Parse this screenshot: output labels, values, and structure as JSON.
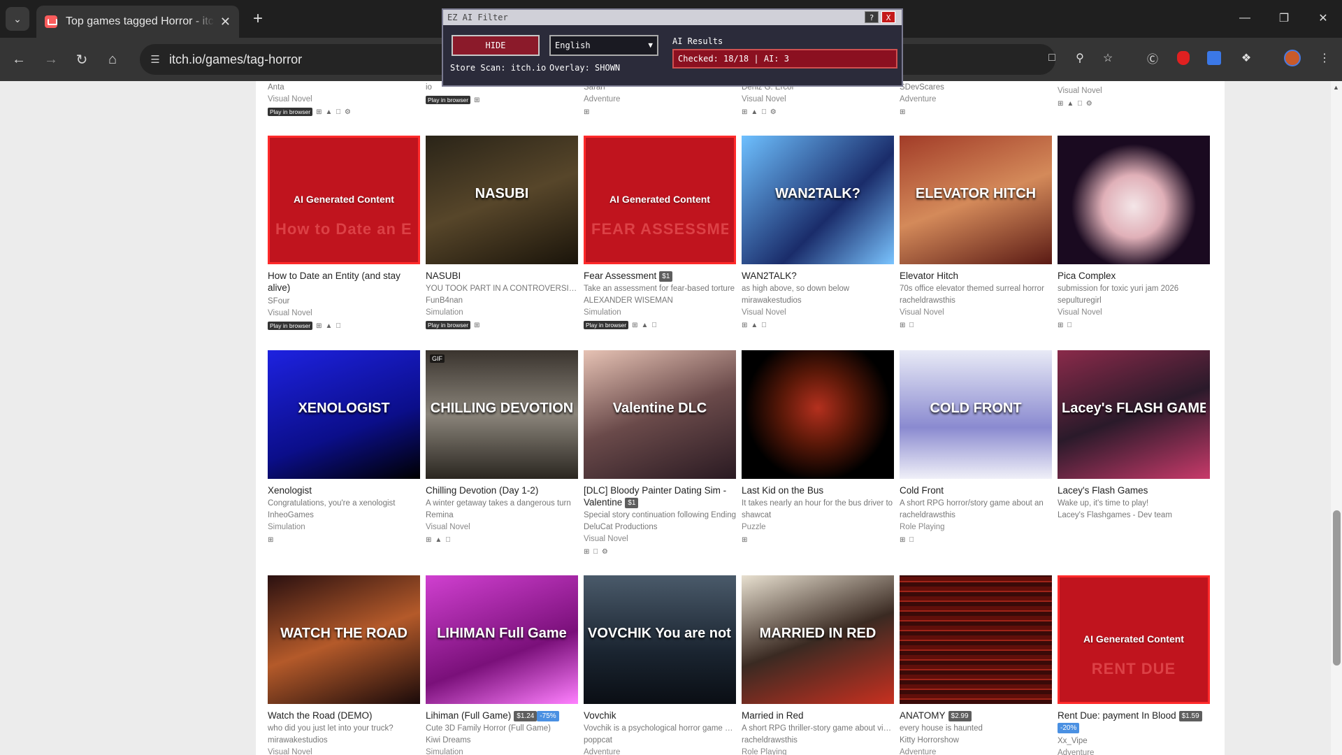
{
  "browser": {
    "tab_title": "Top games tagged Horror - itch.io",
    "url": "itch.io/games/tag-horror",
    "tab_list_icon": "chevron-down",
    "new_tab_label": "+",
    "tab_close_label": "✕",
    "win_min": "—",
    "win_restore": "❐",
    "win_close": "✕"
  },
  "ai_filter": {
    "title": "EZ AI Filter",
    "help_label": "?",
    "close_label": "X",
    "hide_button": "HIDE",
    "language": "English",
    "results_label": "AI Results",
    "results_value": "Checked: 18/18 | AI: 3",
    "store_scan": "Store Scan: itch.io",
    "overlay": "Overlay: SHOWN"
  },
  "prev_row": [
    {
      "author": "Anta",
      "genre": "Visual Novel",
      "pib": "Play in browser",
      "platforms": [
        "win",
        "linux",
        "mac",
        "android"
      ]
    },
    {
      "author": "io",
      "genre": "",
      "pib": "Play in browser",
      "platforms": [
        "win"
      ]
    },
    {
      "author": "Sarah",
      "genre": "Adventure",
      "pib": "",
      "platforms": [
        "win"
      ]
    },
    {
      "author": "Deniz G. Ercor",
      "genre": "Visual Novel",
      "pib": "",
      "platforms": [
        "win",
        "linux",
        "mac",
        "android"
      ]
    },
    {
      "author": "SDevScares",
      "genre": "Adventure",
      "pib": "",
      "platforms": [
        "win"
      ]
    },
    {
      "author": "",
      "genre": "Visual Novel",
      "pib": "",
      "platforms": [
        "win",
        "linux",
        "mac",
        "android"
      ]
    }
  ],
  "ai_overlay_label": "AI Generated Content",
  "games": [
    {
      "title": "How to Date an Entity (and stay alive)",
      "price": "",
      "discount": "",
      "desc": "",
      "author": "SFour",
      "genre": "Visual Novel",
      "pib": "Play in browser",
      "platforms": [
        "win",
        "linux",
        "mac"
      ],
      "ai": true,
      "art": "How to Date an Entity",
      "gif": false
    },
    {
      "title": "NASUBI",
      "price": "",
      "discount": "",
      "desc": "YOU TOOK PART IN A CONTROVERSIAL TV SHOW",
      "author": "FunB4nan",
      "genre": "Simulation",
      "pib": "Play in browser",
      "platforms": [
        "win"
      ],
      "ai": false,
      "art": "NASUBI",
      "gif": false
    },
    {
      "title": "Fear Assessment",
      "price": "$1",
      "discount": "",
      "desc": "Take an assessment for fear-based torture",
      "author": "ALEXANDER WISEMAN",
      "genre": "Simulation",
      "pib": "Play in browser",
      "platforms": [
        "win",
        "linux",
        "mac"
      ],
      "ai": true,
      "art": "FEAR ASSESSMENT",
      "gif": true
    },
    {
      "title": "WAN2TALK?",
      "price": "",
      "discount": "",
      "desc": "as high above, so down below",
      "author": "mirawakestudios",
      "genre": "Visual Novel",
      "pib": "",
      "platforms": [
        "win",
        "linux",
        "mac"
      ],
      "ai": false,
      "art": "WAN2TALK?",
      "gif": false
    },
    {
      "title": "Elevator Hitch",
      "price": "",
      "discount": "",
      "desc": "70s office elevator themed surreal horror",
      "author": "racheldrawsthis",
      "genre": "Visual Novel",
      "pib": "",
      "platforms": [
        "win",
        "mac"
      ],
      "ai": false,
      "art": "ELEVATOR HITCH",
      "gif": false
    },
    {
      "title": "Pica Complex",
      "price": "",
      "discount": "",
      "desc": "submission for toxic yuri jam 2026",
      "author": "sepulturegirl",
      "genre": "Visual Novel",
      "pib": "",
      "platforms": [
        "win",
        "mac"
      ],
      "ai": false,
      "art": "",
      "gif": false
    },
    {
      "title": "Xenologist",
      "price": "",
      "discount": "",
      "desc": "Congratulations, you're a xenologist",
      "author": "InheoGames",
      "genre": "Simulation",
      "pib": "",
      "platforms": [
        "win"
      ],
      "ai": false,
      "art": "XENOLOGIST",
      "gif": false
    },
    {
      "title": "Chilling Devotion (Day 1-2)",
      "price": "",
      "discount": "",
      "desc": "A winter getaway takes a dangerous turn",
      "author": "Remina",
      "genre": "Visual Novel",
      "pib": "",
      "platforms": [
        "win",
        "linux",
        "mac"
      ],
      "ai": false,
      "art": "CHILLING DEVOTION",
      "gif": true
    },
    {
      "title": "[DLC] Bloody Painter Dating Sim - Valentine",
      "price": "$1",
      "discount": "",
      "desc": "Special story continuation following Ending",
      "author": "DeluCat Productions",
      "genre": "Visual Novel",
      "pib": "",
      "platforms": [
        "win",
        "mac",
        "android"
      ],
      "ai": false,
      "art": "Valentine DLC",
      "gif": false
    },
    {
      "title": "Last Kid on the Bus",
      "price": "",
      "discount": "",
      "desc": "It takes nearly an hour for the bus driver to",
      "author": "shawcat",
      "genre": "Puzzle",
      "pib": "",
      "platforms": [
        "win"
      ],
      "ai": false,
      "art": "",
      "gif": false
    },
    {
      "title": "Cold Front",
      "price": "",
      "discount": "",
      "desc": "A short RPG horror/story game about an",
      "author": "racheldrawsthis",
      "genre": "Role Playing",
      "pib": "",
      "platforms": [
        "win",
        "mac"
      ],
      "ai": false,
      "art": "COLD FRONT",
      "gif": false
    },
    {
      "title": "Lacey's Flash Games",
      "price": "",
      "discount": "",
      "desc": "Wake up, it's time to play!",
      "author": "Lacey's Flashgames - Dev team",
      "genre": "",
      "pib": "",
      "platforms": [],
      "ai": false,
      "art": "Lacey's FLASH GAMES",
      "gif": false
    },
    {
      "title": "Watch the Road (DEMO)",
      "price": "",
      "discount": "",
      "desc": "who did you just let into your truck?",
      "author": "mirawakestudios",
      "genre": "Visual Novel",
      "pib": "",
      "platforms": [],
      "ai": false,
      "art": "WATCH THE ROAD",
      "gif": false
    },
    {
      "title": "Lihiman (Full Game)",
      "price": "$1.24",
      "discount": "-75%",
      "desc": "Cute 3D Family Horror (Full Game)",
      "author": "Kiwi Dreams",
      "genre": "Simulation",
      "pib": "",
      "platforms": [],
      "ai": false,
      "art": "LIHIMAN Full Game",
      "gif": false
    },
    {
      "title": "Vovchik",
      "price": "",
      "discount": "",
      "desc": "Vovchik is a psychological horror game about",
      "author": "poppcat",
      "genre": "Adventure",
      "pib": "",
      "platforms": [],
      "ai": false,
      "art": "VOVCHIK You are not alone",
      "gif": false
    },
    {
      "title": "Married in Red",
      "price": "",
      "discount": "",
      "desc": "A short RPG thriller-story game about vision",
      "author": "racheldrawsthis",
      "genre": "Role Playing",
      "pib": "",
      "platforms": [],
      "ai": false,
      "art": "MARRIED IN RED",
      "gif": false
    },
    {
      "title": "ANATOMY",
      "price": "$2.99",
      "discount": "",
      "desc": "every house is haunted",
      "author": "Kitty Horrorshow",
      "genre": "Adventure",
      "pib": "",
      "platforms": [],
      "ai": false,
      "art": "",
      "gif": false
    },
    {
      "title": "Rent Due: payment In Blood",
      "price": "$1.59",
      "discount": "-20%",
      "desc": "",
      "author": "Xx_Vipe",
      "genre": "Adventure",
      "pib": "",
      "platforms": [],
      "ai": true,
      "art": "RENT DUE",
      "gif": false
    }
  ],
  "colors": {
    "ai_red": "#c0141e",
    "chrome_dark": "#1f1f1f",
    "toolbar": "#353535"
  }
}
